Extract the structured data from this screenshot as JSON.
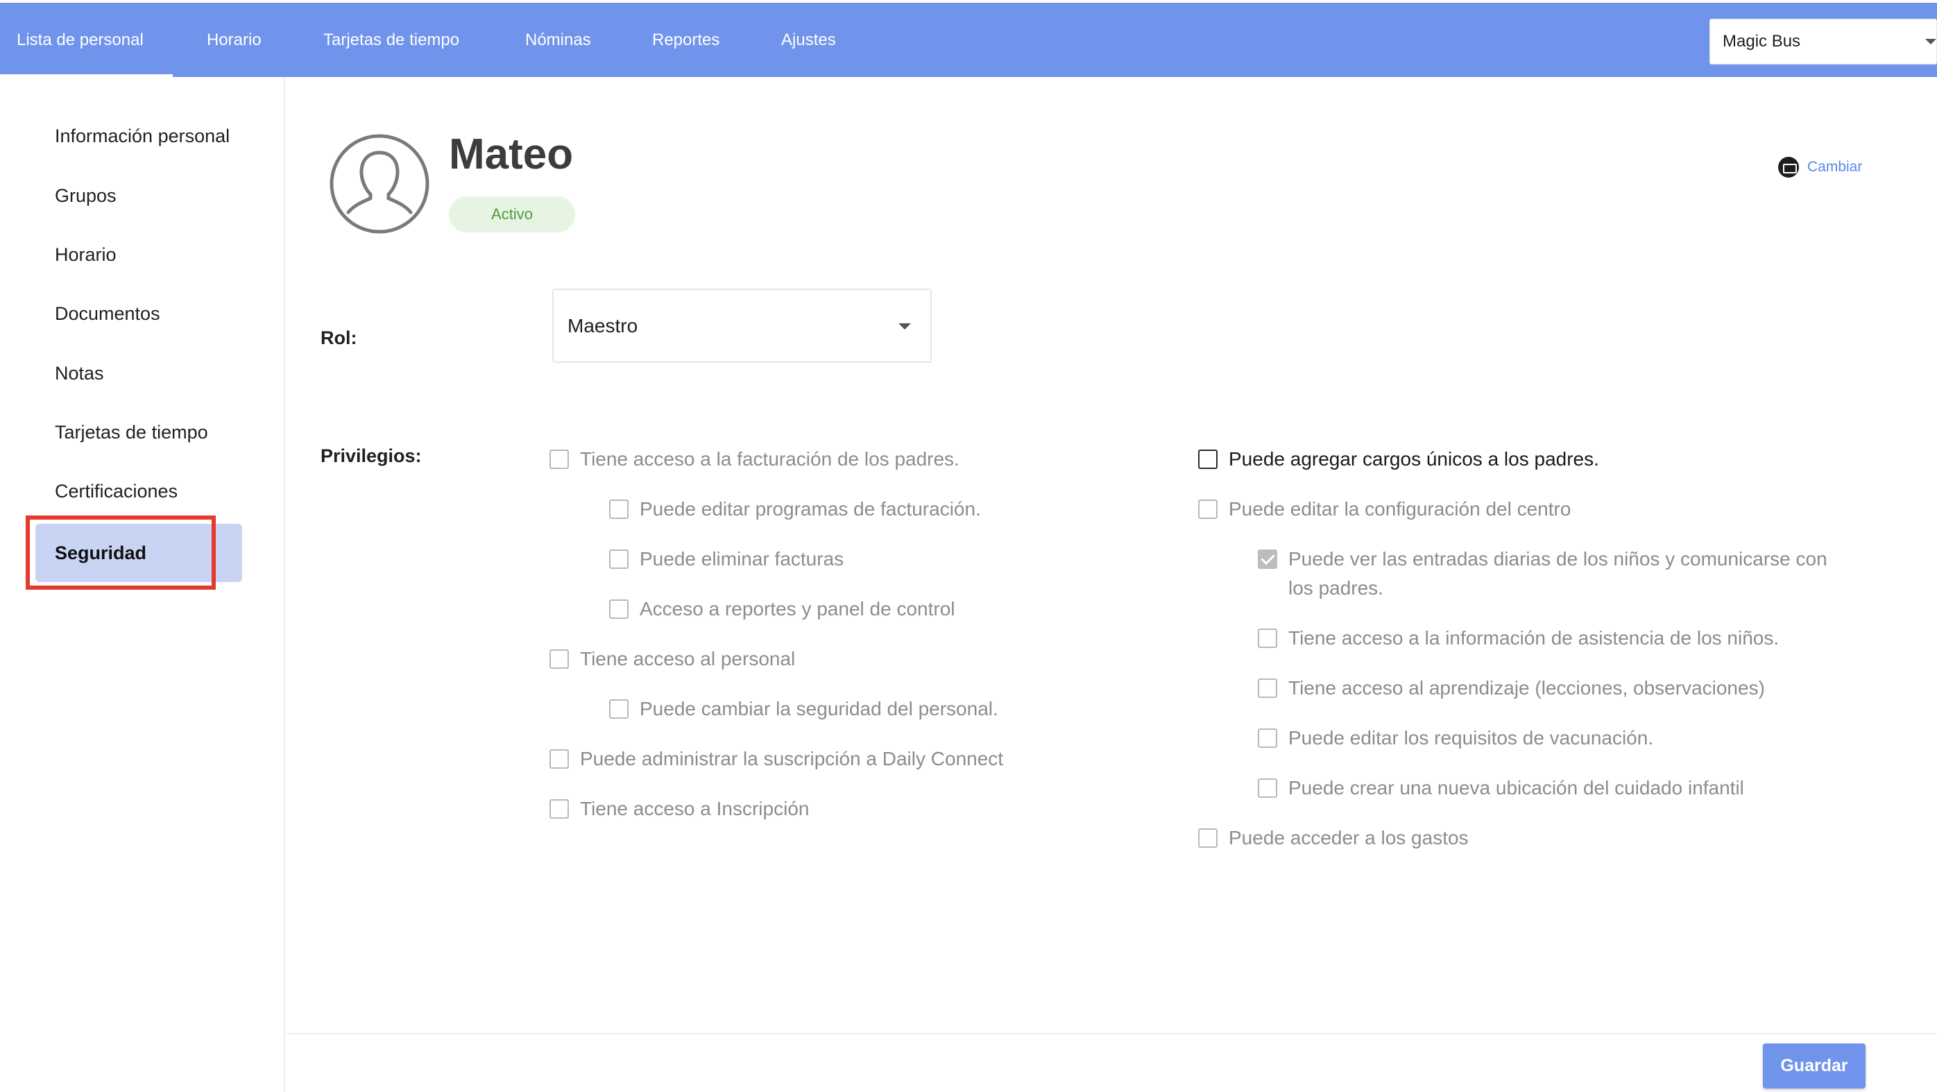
{
  "nav": {
    "tabs": [
      {
        "label": "Lista de personal",
        "active": true
      },
      {
        "label": "Horario",
        "active": false
      },
      {
        "label": "Tarjetas de tiempo",
        "active": false
      },
      {
        "label": "Nóminas",
        "active": false
      },
      {
        "label": "Reportes",
        "active": false
      },
      {
        "label": "Ajustes",
        "active": false
      }
    ],
    "location": "Magic Bus"
  },
  "sidebar": {
    "items": [
      {
        "label": "Información personal"
      },
      {
        "label": "Grupos"
      },
      {
        "label": "Horario"
      },
      {
        "label": "Documentos"
      },
      {
        "label": "Notas"
      },
      {
        "label": "Tarjetas de tiempo"
      },
      {
        "label": "Certificaciones"
      },
      {
        "label": "Seguridad",
        "active": true
      }
    ]
  },
  "profile": {
    "name": "Mateo",
    "status": "Activo",
    "change_label": "Cambiar"
  },
  "role": {
    "label": "Rol:",
    "value": "Maestro"
  },
  "privileges": {
    "label": "Privilegios:",
    "left": [
      {
        "text": "Tiene acceso a la facturación de los padres.",
        "checked": false
      },
      {
        "text": "Puede editar programas de facturación.",
        "checked": false
      },
      {
        "text": "Puede eliminar facturas",
        "checked": false
      },
      {
        "text": "Acceso a reportes y panel de control",
        "checked": false
      },
      {
        "text": "Tiene acceso al personal",
        "checked": false
      },
      {
        "text": "Puede cambiar la seguridad del personal.",
        "checked": false
      },
      {
        "text": "Puede administrar la suscripción a Daily Connect",
        "checked": false
      },
      {
        "text": "Tiene acceso a Inscripción",
        "checked": false
      }
    ],
    "right": [
      {
        "text": "Puede agregar cargos únicos a los padres.",
        "checked": false
      },
      {
        "text": "Puede editar la configuración del centro",
        "checked": false
      },
      {
        "text": "Puede ver las entradas diarias de los niños y comunicarse con los padres.",
        "checked": true
      },
      {
        "text": "Tiene acceso a la información de asistencia de los niños.",
        "checked": false
      },
      {
        "text": "Tiene acceso al aprendizaje (lecciones, observaciones)",
        "checked": false
      },
      {
        "text": "Puede editar los requisitos de vacunación.",
        "checked": false
      },
      {
        "text": "Puede crear una nueva ubicación del cuidado infantil",
        "checked": false
      },
      {
        "text": "Puede acceder a los gastos",
        "checked": false
      }
    ]
  },
  "footer": {
    "save_label": "Guardar"
  },
  "colors": {
    "brand": "#7094ec",
    "active_sidebar_bg": "#c9d4f4",
    "highlight_box": "#e53a2c",
    "status_bg": "#e7f4e4",
    "status_text": "#4e9a3c",
    "link": "#5a87e6"
  },
  "icons": {
    "avatar": "user-avatar-icon",
    "change": "credit-card-icon",
    "dropdown": "chevron-down-icon",
    "check": "checkmark-icon"
  }
}
